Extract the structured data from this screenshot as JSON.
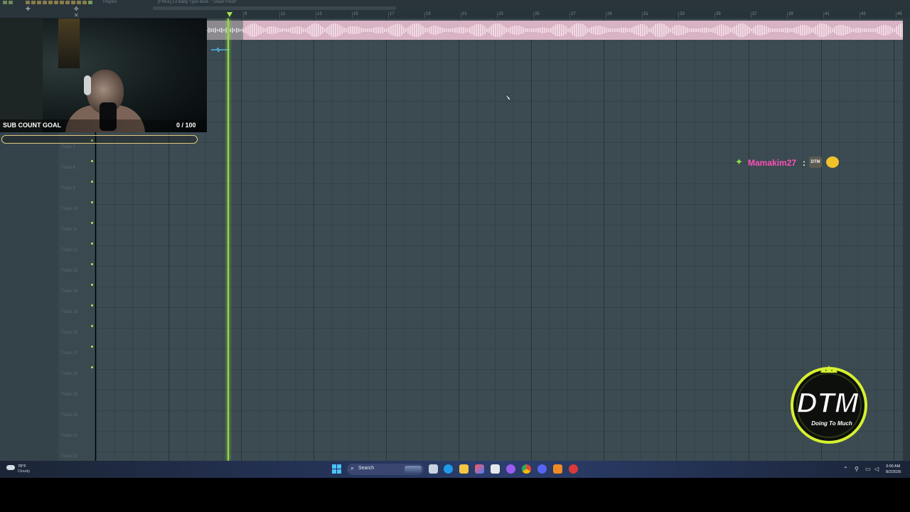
{
  "window": {
    "title": "Playlist",
    "project_title": "[FREE] Lil Baby Type Beat - \"Dead Fresh\""
  },
  "ruler": {
    "bars": [
      "9",
      "11",
      "13",
      "15",
      "17",
      "19",
      "21",
      "23",
      "25",
      "27",
      "29",
      "31",
      "33",
      "35",
      "37",
      "39",
      "41",
      "43",
      "45"
    ]
  },
  "tracks": [
    {
      "label": "Track 7"
    },
    {
      "label": "Track 8"
    },
    {
      "label": "Track 9"
    },
    {
      "label": "Track 10"
    },
    {
      "label": "Track 11"
    },
    {
      "label": "Track 12"
    },
    {
      "label": "Track 13"
    },
    {
      "label": "Track 14"
    },
    {
      "label": "Track 15"
    },
    {
      "label": "Track 16"
    },
    {
      "label": "Track 17"
    },
    {
      "label": "Track 18"
    },
    {
      "label": "Track 19"
    },
    {
      "label": "Track 20"
    },
    {
      "label": "Track 21"
    },
    {
      "label": "Track 22"
    }
  ],
  "overlay": {
    "goal_label": "SUB COUNT GOAL",
    "goal_value": "0 / 100",
    "goal_progress": 0.0,
    "goal_color": "#e0c87a"
  },
  "chat": {
    "username": "Mamakim27",
    "separator": ":",
    "emote_text": "DTM",
    "username_color": "#ff4fb8"
  },
  "logo": {
    "main_text": "DTM",
    "sub_text": "Doing To Much",
    "ring_color": "#d6f030"
  },
  "taskbar": {
    "search_placeholder": "Search",
    "weather_temp": "78°F",
    "weather_condition": "Cloudy",
    "time": "3:00 AM",
    "date": "8/2/2026"
  },
  "colors": {
    "playhead": "#8fdf3a",
    "audio_clip": "#d8b3c3",
    "playlist_bg": "#3c4b52"
  },
  "icons": {
    "playhead_marker": "triangle-down",
    "cursor": "pencil-cursor",
    "weather": "cloud-icon"
  }
}
